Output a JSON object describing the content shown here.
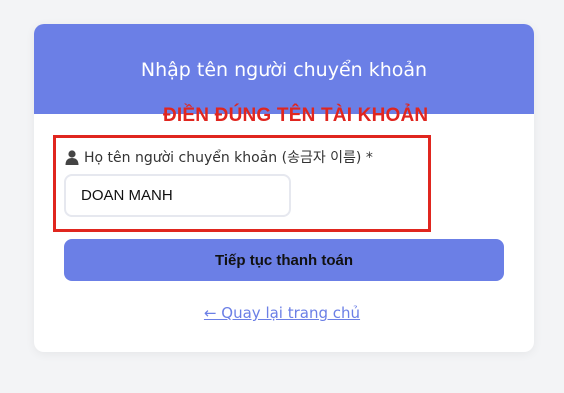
{
  "header": {
    "title": "Nhập tên người chuyển khoản"
  },
  "annotation": {
    "text": "ĐIỀN ĐÚNG TÊN TÀI KHOẢN",
    "color": "#e0261f"
  },
  "form": {
    "label_icon": "person-icon",
    "label": "Họ tên người chuyển khoản (송금자 이름) *",
    "name_value": "DOAN MANH",
    "continue_label": "Tiếp tục thanh toán"
  },
  "footer": {
    "back_link": "← Quay lại trang chủ"
  },
  "colors": {
    "accent": "#6b7fe6",
    "highlight": "#e0261f",
    "background": "#f3f4f6"
  }
}
